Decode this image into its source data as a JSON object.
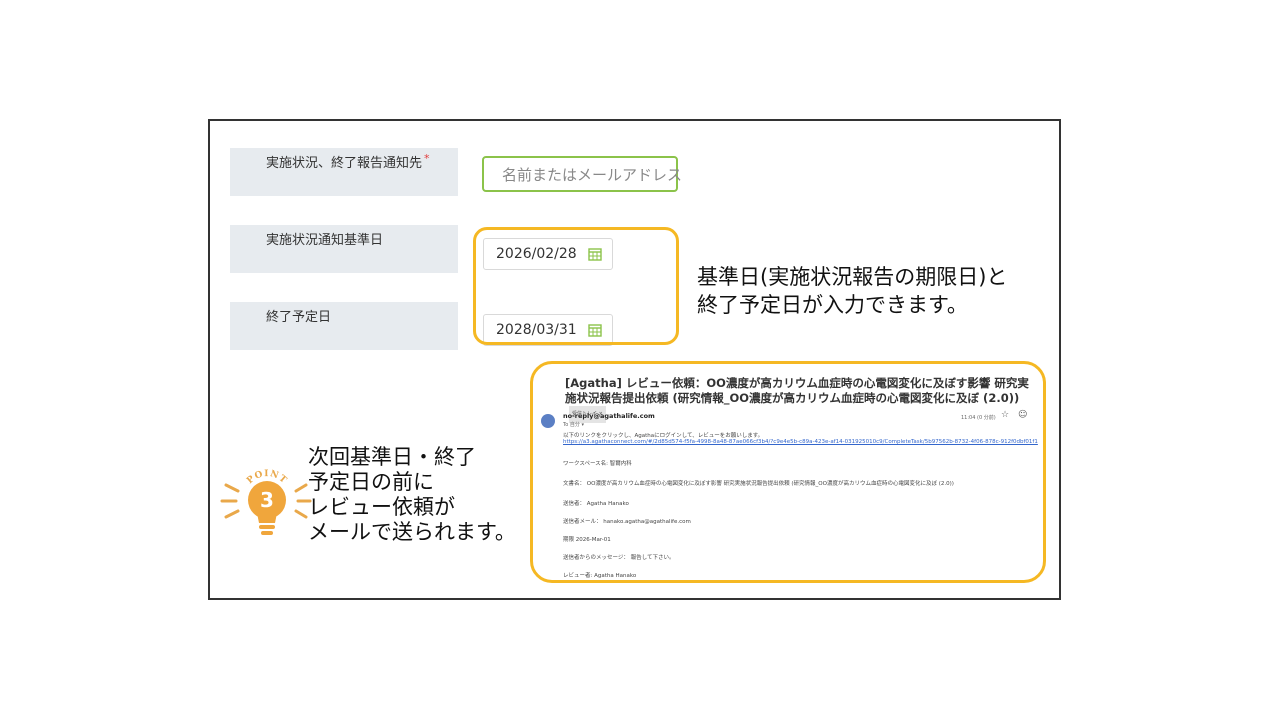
{
  "form": {
    "notify_label": "実施状況、終了報告通知先",
    "required_mark": "*",
    "search_placeholder": "名前またはメールアドレス",
    "base_date_label": "実施状況通知基準日",
    "base_date_value": "2026/02/28",
    "end_date_label": "終了予定日",
    "end_date_value": "2028/03/31"
  },
  "callouts": {
    "dates_line1": "基準日(実施状況報告の期限日)と",
    "dates_line2": "終了予定日が入力できます。",
    "mail_line1": "次回基準日・終了",
    "mail_line2": "予定日の前に",
    "mail_line3": "レビュー依頼が",
    "mail_line4": "メールで送られます。"
  },
  "point_badge": {
    "label": "POINT",
    "number": "3"
  },
  "email": {
    "subject": "[Agatha] レビュー依頼：OO濃度が高カリウム血症時の心電図変化に及ぼす影響 研究実施状況報告提出依頼 (研究情報_OO濃度が高カリウム血症時の心電図変化に及ぼ (2.0))",
    "inbox_tag": "受信トレイ ×",
    "sender": "no-reply@agathalife.com",
    "to": "To 自分 ▾",
    "time": "11:04 (0 分前)",
    "intro": "以下のリンクをクリックし、Agathaにログインして、レビューをお願いします。",
    "link": "https://a3.agathaconnect.com/#/2d85d574-f5fa-4998-8a48-87ae066cf3b4/?c9e4e5b-c89a-423e-af14-031925010c9/CompleteTask/5b97562b-8732-4f06-878c-912f0dbf01f1",
    "workspace": "ワークスペース名: 智爾内科",
    "document": "文書名： OO濃度が高カリウム血症時の心電図変化に及ぼす影響 研究実施状況報告提出依頼 (研究情報_OO濃度が高カリウム血症時の心電図変化に及ぼ (2.0))",
    "sender_name": "送信者： Agatha Hanako",
    "sender_mail": "送信者メール： hanako.agatha@agathalife.com",
    "deadline": "期限 2026-Mar-01",
    "message": "送信者からのメッセージ： 報告して下さい。",
    "reviewer": "レビュー者: Agatha Hanako"
  },
  "colors": {
    "highlight": "#f5b823",
    "search_border": "#8bc34a",
    "calendar": "#8bc34a",
    "label_bg": "#e7ebef",
    "link": "#3366cc"
  }
}
